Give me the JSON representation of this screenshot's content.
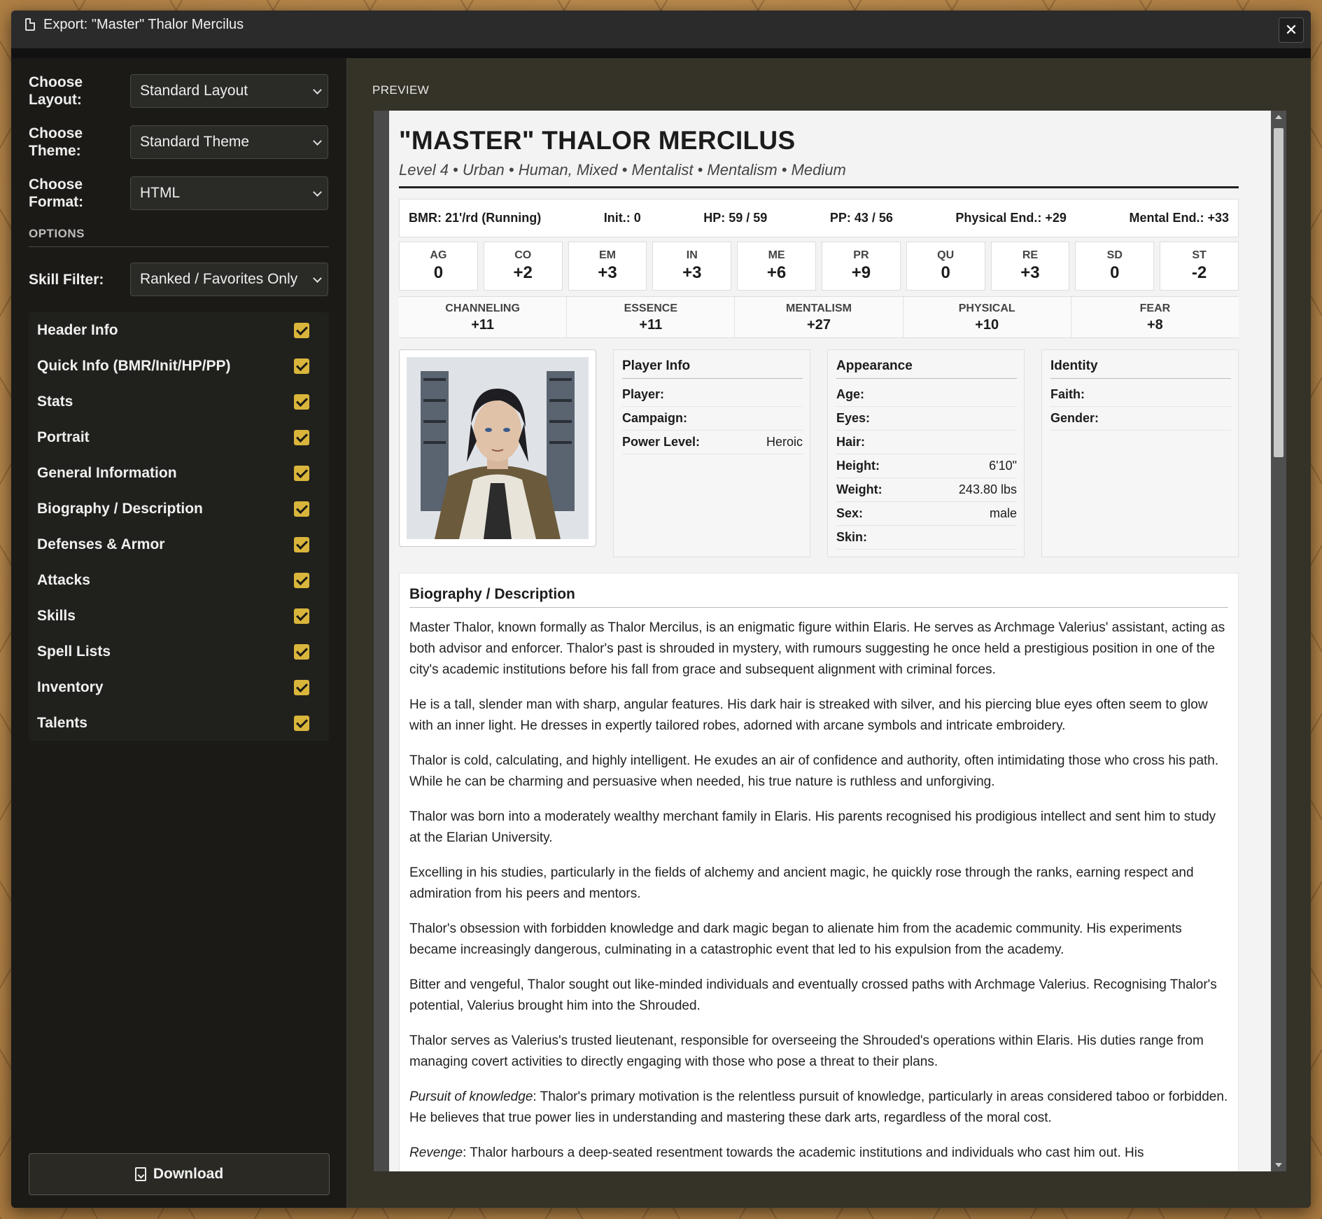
{
  "window": {
    "title": "Export: \"Master\" Thalor Mercilus"
  },
  "left": {
    "layout_label": "Choose Layout:",
    "layout_value": "Standard Layout",
    "theme_label": "Choose Theme:",
    "theme_value": "Standard Theme",
    "format_label": "Choose Format:",
    "format_value": "HTML",
    "options_title": "OPTIONS",
    "skill_filter_label": "Skill Filter:",
    "skill_filter_value": "Ranked / Favorites Only",
    "checks": [
      "Header Info",
      "Quick Info (BMR/Init/HP/PP)",
      "Stats",
      "Portrait",
      "General Information",
      "Biography / Description",
      "Defenses & Armor",
      "Attacks",
      "Skills",
      "Spell Lists",
      "Inventory",
      "Talents"
    ],
    "download_label": "Download"
  },
  "preview": {
    "label": "PREVIEW",
    "name": "\"MASTER\" THALOR MERCILUS",
    "subtitle": "Level 4 • Urban • Human, Mixed • Mentalist • Mentalism • Medium",
    "quick": {
      "bmr": "BMR: 21'/rd (Running)",
      "init": "Init.: 0",
      "hp": "HP: 59 / 59",
      "pp": "PP: 43 / 56",
      "phys": "Physical End.: +29",
      "ment": "Mental End.: +33"
    },
    "stats": [
      {
        "k": "AG",
        "v": "0"
      },
      {
        "k": "CO",
        "v": "+2"
      },
      {
        "k": "EM",
        "v": "+3"
      },
      {
        "k": "IN",
        "v": "+3"
      },
      {
        "k": "ME",
        "v": "+6"
      },
      {
        "k": "PR",
        "v": "+9"
      },
      {
        "k": "QU",
        "v": "0"
      },
      {
        "k": "RE",
        "v": "+3"
      },
      {
        "k": "SD",
        "v": "0"
      },
      {
        "k": "ST",
        "v": "-2"
      }
    ],
    "rr": [
      {
        "k": "CHANNELING",
        "v": "+11"
      },
      {
        "k": "ESSENCE",
        "v": "+11"
      },
      {
        "k": "MENTALISM",
        "v": "+27"
      },
      {
        "k": "PHYSICAL",
        "v": "+10"
      },
      {
        "k": "FEAR",
        "v": "+8"
      }
    ],
    "player_info": {
      "title": "Player Info",
      "rows": [
        {
          "k": "Player:",
          "v": ""
        },
        {
          "k": "Campaign:",
          "v": ""
        },
        {
          "k": "Power Level:",
          "v": "Heroic"
        }
      ]
    },
    "appearance": {
      "title": "Appearance",
      "rows": [
        {
          "k": "Age:",
          "v": ""
        },
        {
          "k": "Eyes:",
          "v": ""
        },
        {
          "k": "Hair:",
          "v": ""
        },
        {
          "k": "Height:",
          "v": "6'10\""
        },
        {
          "k": "Weight:",
          "v": "243.80 lbs"
        },
        {
          "k": "Sex:",
          "v": "male"
        },
        {
          "k": "Skin:",
          "v": ""
        }
      ]
    },
    "identity": {
      "title": "Identity",
      "rows": [
        {
          "k": "Faith:",
          "v": ""
        },
        {
          "k": "Gender:",
          "v": ""
        }
      ]
    },
    "bio": {
      "title": "Biography / Description",
      "p1": "Master Thalor, known formally as Thalor Mercilus, is an enigmatic figure within Elaris. He serves as Archmage Valerius' assistant, acting as both advisor and enforcer. Thalor's past is shrouded in mystery, with rumours suggesting he once held a prestigious position in one of the city's academic institutions before his fall from grace and subsequent alignment with criminal forces.",
      "p2": "He is a tall, slender man with sharp, angular features. His dark hair is streaked with silver, and his piercing blue eyes often seem to glow with an inner light. He dresses in expertly tailored robes, adorned with arcane symbols and intricate embroidery.",
      "p3": "Thalor is cold, calculating, and highly intelligent. He exudes an air of confidence and authority, often intimidating those who cross his path. While he can be charming and persuasive when needed, his true nature is ruthless and unforgiving.",
      "p4": "Thalor was born into a moderately wealthy merchant family in Elaris. His parents recognised his prodigious intellect and sent him to study at the Elarian University.",
      "p5": "Excelling in his studies, particularly in the fields of alchemy and ancient magic, he quickly rose through the ranks, earning respect and admiration from his peers and mentors.",
      "p6": "Thalor's obsession with forbidden knowledge and dark magic began to alienate him from the academic community. His experiments became increasingly dangerous, culminating in a catastrophic event that led to his expulsion from the academy.",
      "p7": "Bitter and vengeful, Thalor sought out like-minded individuals and eventually crossed paths with Archmage Valerius. Recognising Thalor's potential, Valerius brought him into the Shrouded.",
      "p8": "Thalor serves as Valerius's trusted lieutenant, responsible for overseeing the Shrouded's operations within Elaris. His duties range from managing covert activities to directly engaging with those who pose a threat to their plans.",
      "p9_label": "Pursuit of knowledge",
      "p9": ": Thalor's primary motivation is the relentless pursuit of knowledge, particularly in areas considered taboo or forbidden. He believes that true power lies in understanding and mastering these dark arts, regardless of the moral cost.",
      "p10_label": "Revenge",
      "p10": ": Thalor harbours a deep-seated resentment towards the academic institutions and individuals who cast him out. His"
    }
  }
}
